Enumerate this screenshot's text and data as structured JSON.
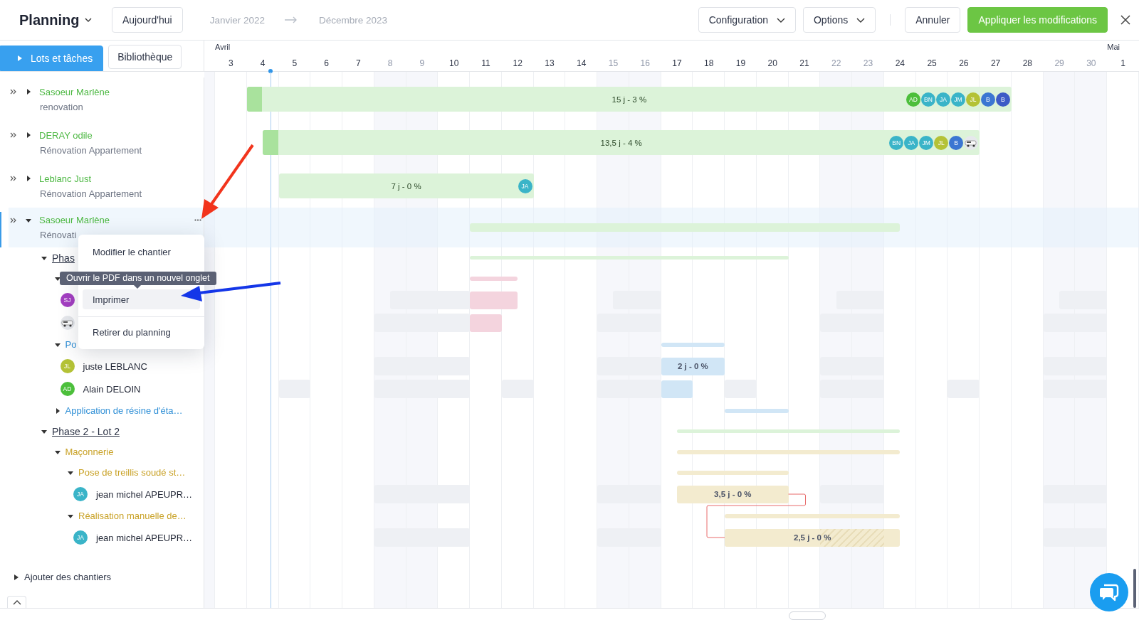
{
  "header": {
    "title": "Planning",
    "today_button": "Aujourd'hui",
    "range_start": "Janvier 2022",
    "range_end": "Décembre 2023",
    "menus": [
      "Configuration",
      "Options"
    ],
    "cancel": "Annuler",
    "apply": "Appliquer les modifications"
  },
  "tabs": [
    {
      "label": "Lots et tâches",
      "selected": true
    },
    {
      "label": "Bibliothèque",
      "selected": false
    }
  ],
  "days": [
    {
      "weekend": true
    },
    {
      "label": "3",
      "month": "Avril",
      "weekend": false
    },
    {
      "label": "4",
      "weekend": false
    },
    {
      "label": "5",
      "weekend": false
    },
    {
      "label": "6",
      "weekend": false
    },
    {
      "label": "7",
      "weekend": false
    },
    {
      "label": "8",
      "weekend": true
    },
    {
      "label": "9",
      "weekend": true
    },
    {
      "label": "10",
      "weekend": false
    },
    {
      "label": "11",
      "weekend": false
    },
    {
      "label": "12",
      "weekend": false
    },
    {
      "label": "13",
      "weekend": false
    },
    {
      "label": "14",
      "weekend": false
    },
    {
      "label": "15",
      "weekend": true
    },
    {
      "label": "16",
      "weekend": true
    },
    {
      "label": "17",
      "weekend": false
    },
    {
      "label": "18",
      "weekend": false
    },
    {
      "label": "19",
      "weekend": false
    },
    {
      "label": "20",
      "weekend": false
    },
    {
      "label": "21",
      "weekend": false
    },
    {
      "label": "22",
      "weekend": true
    },
    {
      "label": "23",
      "weekend": true
    },
    {
      "label": "24",
      "weekend": false
    },
    {
      "label": "25",
      "weekend": false
    },
    {
      "label": "26",
      "weekend": false
    },
    {
      "label": "27",
      "weekend": false
    },
    {
      "label": "28",
      "weekend": false
    },
    {
      "label": "29",
      "weekend": true
    },
    {
      "label": "30",
      "weekend": true
    },
    {
      "label": "1",
      "month": "Mai",
      "weekend": false
    }
  ],
  "rows": [
    {
      "kind": "project",
      "name": "Sasoeur Marlène",
      "subtitle": "renovation",
      "expanded": false,
      "selected": false,
      "bar": {
        "kind": "block",
        "label": "15 j - 3 %",
        "level": 0.02,
        "color": "#dcf3d9",
        "avatars": [
          {
            "initials": "AD",
            "color": "#4cbf3b"
          },
          {
            "initials": "BN",
            "color": "#3ab4c8"
          },
          {
            "initials": "JA",
            "color": "#3ab4c8"
          },
          {
            "initials": "JM",
            "color": "#3ab4c8"
          },
          {
            "initials": "JL",
            "color": "#b4c236"
          },
          {
            "initials": "B",
            "color": "#3b76d2"
          },
          {
            "initials": "B",
            "color": "#3d5bc6"
          }
        ]
      }
    },
    {
      "kind": "project",
      "name": "DERAY odile",
      "subtitle": "Rénovation Appartement",
      "expanded": false,
      "selected": false,
      "bar": {
        "kind": "block",
        "label": "13,5 j - 4 %",
        "level": 0.022,
        "color": "#dcf3d9",
        "avatars": [
          {
            "initials": "BN",
            "color": "#3ab4c8"
          },
          {
            "initials": "JA",
            "color": "#3ab4c8"
          },
          {
            "initials": "JM",
            "color": "#3ab4c8"
          },
          {
            "initials": "JL",
            "color": "#b4c236"
          },
          {
            "initials": "B",
            "color": "#3b76d2"
          },
          {
            "kind": "picture"
          }
        ]
      }
    },
    {
      "kind": "project",
      "name": "Leblanc Just",
      "subtitle": "Rénovation Appartement",
      "expanded": false,
      "selected": false,
      "bar": {
        "kind": "block",
        "label": "7 j - 0 %",
        "color": "#dcf3d9",
        "avatars": [
          {
            "initials": "JA",
            "color": "#3ab4c8"
          }
        ]
      }
    },
    {
      "kind": "project",
      "name": "Sasoeur Marlène",
      "subtitle": "Rénovati",
      "expanded": true,
      "selected": true,
      "bar": {
        "kind": "line",
        "color": "#dcf3d9"
      },
      "children": [
        {
          "kind": "phase",
          "label": "Phas",
          "expanded": true,
          "bar": {
            "kind": "line",
            "color": "#dcf3d9"
          },
          "children": [
            {
              "kind": "task",
              "expanded": true,
              "bar": {
                "kind": "line",
                "color": "#f4d4de"
              },
              "children": [
                {
                  "kind": "resource",
                  "avatar": {
                    "initials": "SJ",
                    "color": "#a43fc2"
                  },
                  "bar": {
                    "kind": "block",
                    "color": "#f4d4de"
                  }
                },
                {
                  "kind": "resource",
                  "avatar": {
                    "kind": "picture"
                  },
                  "bar": {
                    "kind": "block",
                    "color": "#f4d4de"
                  }
                }
              ]
            },
            {
              "kind": "task",
              "label": "Po",
              "color": "#2f8fd6",
              "expanded": true,
              "bar": {
                "kind": "line"
              },
              "children": [
                {
                  "kind": "resource",
                  "name": "juste LEBLANC",
                  "avatar": {
                    "initials": "JL",
                    "color": "#b4c236"
                  },
                  "bar": {
                    "kind": "block",
                    "label": "2 j - 0 %"
                  }
                },
                {
                  "kind": "resource",
                  "name": "Alain DELOIN",
                  "avatar": {
                    "initials": "AD",
                    "color": "#4cbf3b"
                  },
                  "bar": {
                    "kind": "block"
                  }
                }
              ]
            },
            {
              "kind": "task",
              "label": "Application de résine d'éta…",
              "color": "#2f8fd6",
              "expanded": false,
              "bar": {
                "kind": "line"
              }
            }
          ]
        },
        {
          "kind": "phase",
          "label": "Phase 2 - Lot 2",
          "expanded": true,
          "bar": {
            "kind": "line",
            "color": "#dcf3d9"
          },
          "children": [
            {
              "kind": "task",
              "label": "Maçonnerie",
              "color": "#c9a227",
              "expanded": true,
              "bar": {
                "kind": "line"
              },
              "children": [
                {
                  "kind": "task",
                  "label": "Pose de treillis soudé st…",
                  "color": "#c9a227",
                  "expanded": true,
                  "bar": {
                    "kind": "line"
                  },
                  "children": [
                    {
                      "kind": "resource",
                      "name": "jean michel APEUPR…",
                      "avatar": {
                        "initials": "JA",
                        "color": "#3ab4c8"
                      },
                      "bar": {
                        "kind": "block",
                        "label": "3,5 j - 0 %"
                      }
                    }
                  ]
                },
                {
                  "kind": "task",
                  "label": "Réalisation manuelle de…",
                  "color": "#c9a227",
                  "expanded": true,
                  "bar": {
                    "kind": "line"
                  },
                  "children": [
                    {
                      "kind": "resource",
                      "name": "jean michel APEUPR…",
                      "avatar": {
                        "initials": "JA",
                        "color": "#3ab4c8"
                      },
                      "bar": {
                        "kind": "block",
                        "label": "2,5 j - 0 %",
                        "link": true,
                        "hatched": true
                      }
                    }
                  ]
                }
              ]
            }
          ]
        }
      ]
    }
  ],
  "add_label": "Ajouter des chantiers",
  "menu": {
    "items": [
      {
        "label": "Modifier le chantier",
        "selected": false
      },
      {
        "label": "Imprimer",
        "selected": true,
        "tooltip": "Ouvrir le PDF dans un nouvel onglet"
      },
      {
        "label": "Retirer du planning",
        "selected": false,
        "divider": true
      }
    ]
  },
  "annotations": [
    {
      "color": "#f2341c"
    },
    {
      "color": "#1436e8"
    }
  ]
}
